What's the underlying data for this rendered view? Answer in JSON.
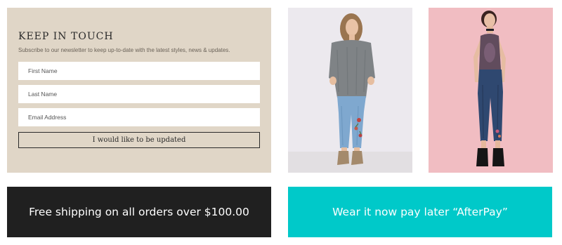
{
  "newsletter": {
    "title": "KEEP IN TOUCH",
    "subtitle": "Subscribe to our newsletter to keep up-to-date with the latest styles, news & updates.",
    "first_name_placeholder": "First Name",
    "last_name_placeholder": "Last Name",
    "email_placeholder": "Email Address",
    "submit_label": "I would like to be updated",
    "background": "#e0d6c7"
  },
  "photos": [
    {
      "name": "model-grey-sweater-jeans-photo",
      "background": "#ece9ee"
    },
    {
      "name": "model-mesh-top-jeans-photo",
      "background": "#f0b8be"
    }
  ],
  "banners": {
    "shipping_text": "Free shipping on all orders over $100.00",
    "shipping_background": "#202020",
    "afterpay_text": "Wear it now pay later “AfterPay”",
    "afterpay_background": "#00c9c9"
  }
}
